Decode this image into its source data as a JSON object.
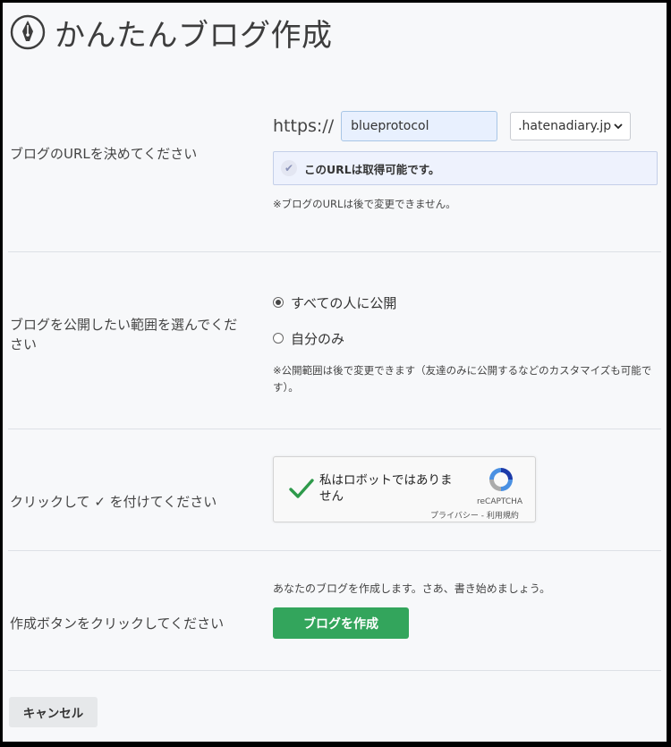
{
  "page": {
    "title": "かんたんブログ作成",
    "logo_icon": "pen-nib-icon"
  },
  "url_section": {
    "label": "ブログのURLを決めてください",
    "scheme": "https://",
    "subdomain_value": "blueprotocol",
    "domain_selected": ".hatenadiary.jp",
    "availability_message": "このURLは取得可能です。",
    "note": "※ブログのURLは後で変更できません。"
  },
  "visibility_section": {
    "label": "ブログを公開したい範囲を選んでください",
    "options": [
      {
        "label": "すべての人に公開",
        "checked": true
      },
      {
        "label": "自分のみ",
        "checked": false
      }
    ],
    "note": "※公開範囲は後で変更できます（友達のみに公開するなどのカスタマイズも可能です）。"
  },
  "captcha_section": {
    "label": "クリックして ✓ を付けてください",
    "checkbox_text": "私はロボットではありません",
    "brand": "reCAPTCHA",
    "privacy_link": "プライバシー",
    "separator": " - ",
    "terms_link": "利用規約",
    "check_color": "#2e9a4b"
  },
  "create_section": {
    "label": "作成ボタンをクリックしてください",
    "message": "あなたのブログを作成します。さあ、書き始めましょう。",
    "button_label": "ブログを作成",
    "button_color": "#33a55c"
  },
  "footer": {
    "cancel_label": "キャンセル"
  }
}
